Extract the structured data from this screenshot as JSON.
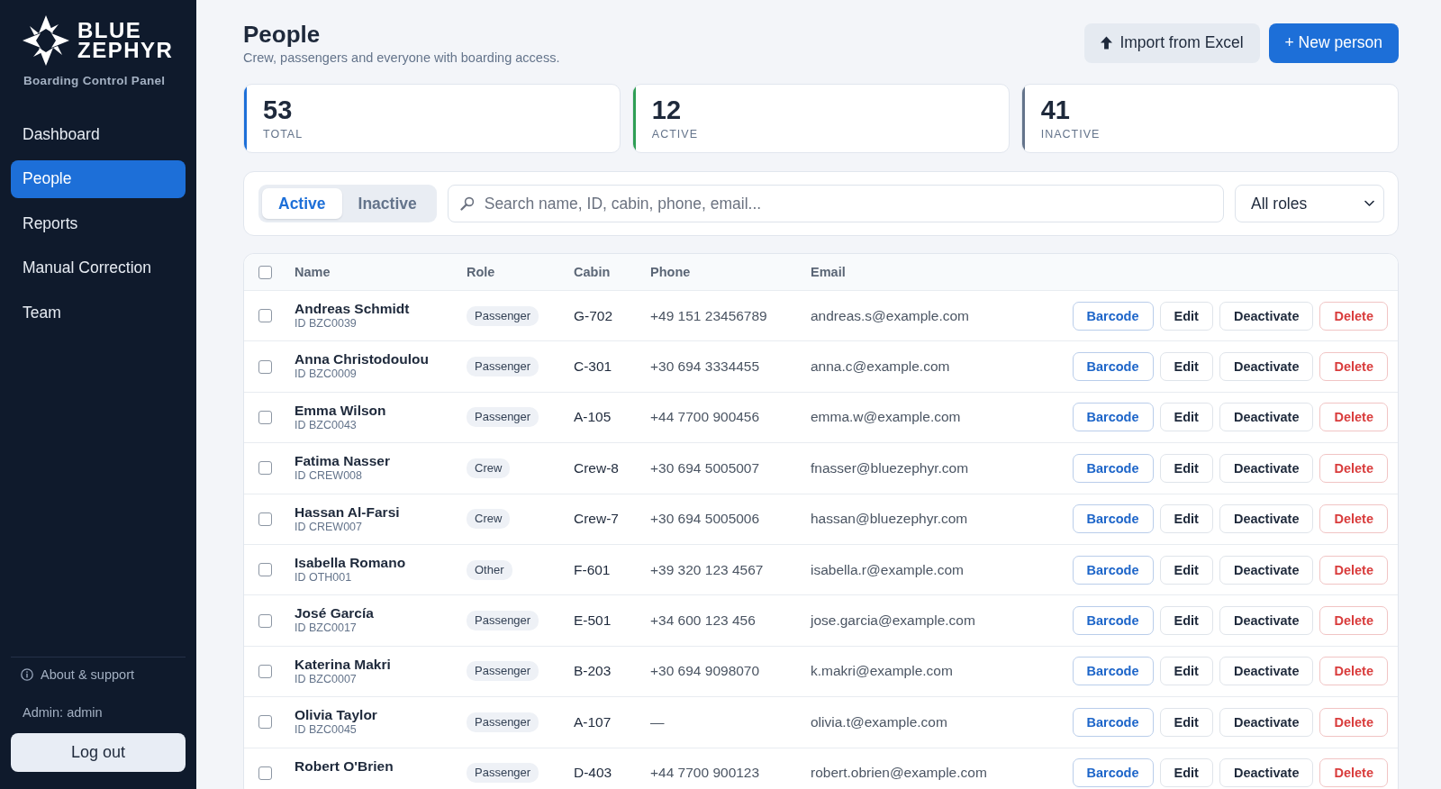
{
  "sidebar": {
    "brand": {
      "name": "BLUE ZEPHYR",
      "tagline": "Boarding Control Panel"
    },
    "nav": [
      {
        "label": "Dashboard",
        "selected": false
      },
      {
        "label": "People",
        "selected": true
      },
      {
        "label": "Reports",
        "selected": false
      },
      {
        "label": "Manual Correction",
        "selected": false
      },
      {
        "label": "Team",
        "selected": false
      }
    ],
    "footer": {
      "about": "About & support",
      "user": "Admin: admin",
      "logout": "Log out"
    }
  },
  "header": {
    "title": "People",
    "subtitle": "Crew, passengers and everyone with boarding access.",
    "buttons": [
      {
        "label": "Import from Excel",
        "kind": "import"
      },
      {
        "label": "+ New person",
        "kind": "create"
      }
    ]
  },
  "stats": [
    {
      "value": "53",
      "label": "TOTAL",
      "color": "#1d6fd8"
    },
    {
      "value": "12",
      "label": "ACTIVE",
      "color": "#2f9e55"
    },
    {
      "value": "41",
      "label": "INACTIVE",
      "color": "#64748b"
    }
  ],
  "filters": {
    "tabs": [
      {
        "label": "Active",
        "selected": true
      },
      {
        "label": "Inactive",
        "selected": false
      }
    ],
    "search": {
      "placeholder": "Search name, ID, cabin, phone, email..."
    },
    "role_select": {
      "value": "All roles"
    }
  },
  "table": {
    "select_all": {
      "checked": false
    },
    "columns": [
      "Name",
      "Role",
      "Cabin",
      "Phone",
      "Email"
    ],
    "rows": [
      {
        "checked": false,
        "name": "Andreas Schmidt",
        "id": "ID BZC0039",
        "role": "Passenger",
        "cabin": "G-702",
        "phone": "+49 151 23456789",
        "email": "andreas.s@example.com",
        "actions": [
          {
            "label": "Barcode",
            "kind": "barcode"
          },
          {
            "label": "Edit",
            "kind": "edit"
          },
          {
            "label": "Deactivate",
            "kind": "deactivate"
          },
          {
            "label": "Delete",
            "kind": "delete"
          }
        ]
      },
      {
        "checked": false,
        "name": "Anna Christodoulou",
        "id": "ID BZC0009",
        "role": "Passenger",
        "cabin": "C-301",
        "phone": "+30 694 3334455",
        "email": "anna.c@example.com",
        "actions": [
          {
            "label": "Barcode",
            "kind": "barcode"
          },
          {
            "label": "Edit",
            "kind": "edit"
          },
          {
            "label": "Deactivate",
            "kind": "deactivate"
          },
          {
            "label": "Delete",
            "kind": "delete"
          }
        ]
      },
      {
        "checked": false,
        "name": "Emma Wilson",
        "id": "ID BZC0043",
        "role": "Passenger",
        "cabin": "A-105",
        "phone": "+44 7700 900456",
        "email": "emma.w@example.com",
        "actions": [
          {
            "label": "Barcode",
            "kind": "barcode"
          },
          {
            "label": "Edit",
            "kind": "edit"
          },
          {
            "label": "Deactivate",
            "kind": "deactivate"
          },
          {
            "label": "Delete",
            "kind": "delete"
          }
        ]
      },
      {
        "checked": false,
        "name": "Fatima Nasser",
        "id": "ID CREW008",
        "role": "Crew",
        "cabin": "Crew-8",
        "phone": "+30 694 5005007",
        "email": "fnasser@bluezephyr.com",
        "actions": [
          {
            "label": "Barcode",
            "kind": "barcode"
          },
          {
            "label": "Edit",
            "kind": "edit"
          },
          {
            "label": "Deactivate",
            "kind": "deactivate"
          },
          {
            "label": "Delete",
            "kind": "delete"
          }
        ]
      },
      {
        "checked": false,
        "name": "Hassan Al-Farsi",
        "id": "ID CREW007",
        "role": "Crew",
        "cabin": "Crew-7",
        "phone": "+30 694 5005006",
        "email": "hassan@bluezephyr.com",
        "actions": [
          {
            "label": "Barcode",
            "kind": "barcode"
          },
          {
            "label": "Edit",
            "kind": "edit"
          },
          {
            "label": "Deactivate",
            "kind": "deactivate"
          },
          {
            "label": "Delete",
            "kind": "delete"
          }
        ]
      },
      {
        "checked": false,
        "name": "Isabella Romano",
        "id": "ID OTH001",
        "role": "Other",
        "cabin": "F-601",
        "phone": "+39 320 123 4567",
        "email": "isabella.r@example.com",
        "actions": [
          {
            "label": "Barcode",
            "kind": "barcode"
          },
          {
            "label": "Edit",
            "kind": "edit"
          },
          {
            "label": "Deactivate",
            "kind": "deactivate"
          },
          {
            "label": "Delete",
            "kind": "delete"
          }
        ]
      },
      {
        "checked": false,
        "name": "José García",
        "id": "ID BZC0017",
        "role": "Passenger",
        "cabin": "E-501",
        "phone": "+34 600 123 456",
        "email": "jose.garcia@example.com",
        "actions": [
          {
            "label": "Barcode",
            "kind": "barcode"
          },
          {
            "label": "Edit",
            "kind": "edit"
          },
          {
            "label": "Deactivate",
            "kind": "deactivate"
          },
          {
            "label": "Delete",
            "kind": "delete"
          }
        ]
      },
      {
        "checked": false,
        "name": "Katerina Makri",
        "id": "ID BZC0007",
        "role": "Passenger",
        "cabin": "B-203",
        "phone": "+30 694 9098070",
        "email": "k.makri@example.com",
        "actions": [
          {
            "label": "Barcode",
            "kind": "barcode"
          },
          {
            "label": "Edit",
            "kind": "edit"
          },
          {
            "label": "Deactivate",
            "kind": "deactivate"
          },
          {
            "label": "Delete",
            "kind": "delete"
          }
        ]
      },
      {
        "checked": false,
        "name": "Olivia Taylor",
        "id": "ID BZC0045",
        "role": "Passenger",
        "cabin": "A-107",
        "phone": "—",
        "email": "olivia.t@example.com",
        "actions": [
          {
            "label": "Barcode",
            "kind": "barcode"
          },
          {
            "label": "Edit",
            "kind": "edit"
          },
          {
            "label": "Deactivate",
            "kind": "deactivate"
          },
          {
            "label": "Delete",
            "kind": "delete"
          }
        ]
      },
      {
        "checked": false,
        "name": "Robert O'Brien",
        "role": "Passenger",
        "cabin": "D-403",
        "phone": "+44 7700 900123",
        "email": "robert.obrien@example.com",
        "actions": [
          {
            "label": "Barcode",
            "kind": "barcode"
          },
          {
            "label": "Edit",
            "kind": "edit"
          },
          {
            "label": "Deactivate",
            "kind": "deactivate"
          },
          {
            "label": "Delete",
            "kind": "delete"
          }
        ]
      }
    ]
  }
}
